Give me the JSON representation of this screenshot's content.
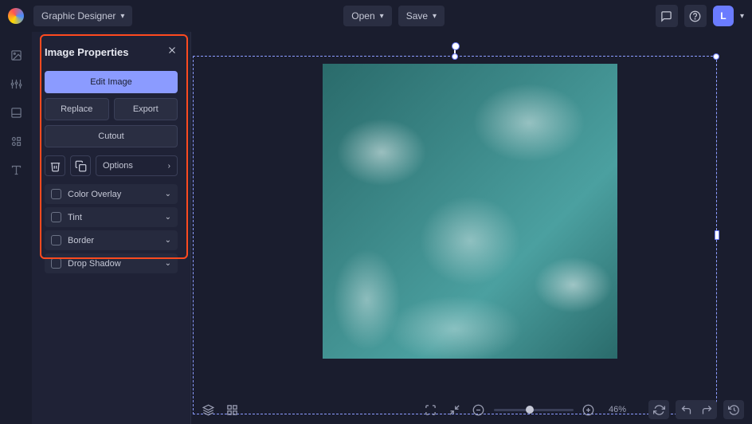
{
  "topbar": {
    "workspace_label": "Graphic Designer",
    "open_label": "Open",
    "save_label": "Save",
    "avatar_letter": "L"
  },
  "panel": {
    "title": "Image Properties",
    "edit_image_label": "Edit Image",
    "replace_label": "Replace",
    "export_label": "Export",
    "cutout_label": "Cutout",
    "options_label": "Options",
    "effects": [
      "Color Overlay",
      "Tint",
      "Border",
      "Drop Shadow"
    ]
  },
  "bottombar": {
    "zoom_percent": "46%"
  }
}
